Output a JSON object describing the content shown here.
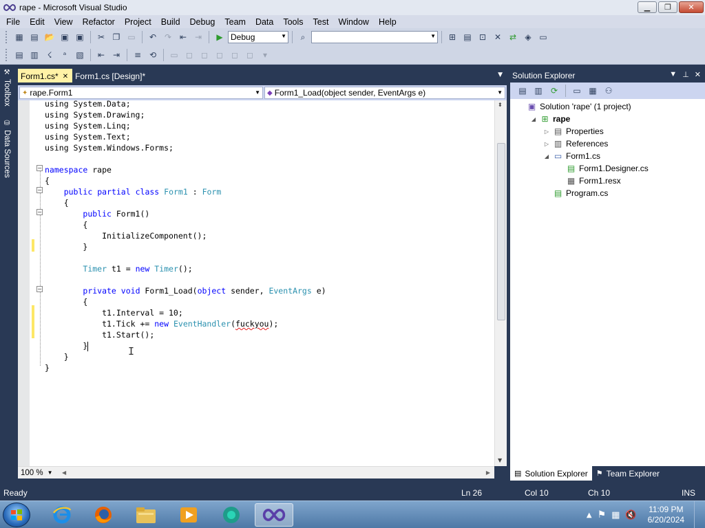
{
  "window": {
    "title": "rape - Microsoft Visual Studio",
    "icon": "vs-infinity-icon"
  },
  "menu": [
    "File",
    "Edit",
    "View",
    "Refactor",
    "Project",
    "Build",
    "Debug",
    "Team",
    "Data",
    "Tools",
    "Test",
    "Window",
    "Help"
  ],
  "toolbar": {
    "config_value": "Debug",
    "find_value": ""
  },
  "left_rail": {
    "toolbox": "Toolbox",
    "data_sources": "Data Sources"
  },
  "editor": {
    "tabs": [
      {
        "label": "Form1.cs*",
        "active": true
      },
      {
        "label": "Form1.cs [Design]*",
        "active": false
      }
    ],
    "nav_class": "rape.Form1",
    "nav_member": "Form1_Load(object sender, EventArgs e)",
    "zoom": "100 %",
    "code_lines": [
      [
        {
          "t": "using System.Data;"
        }
      ],
      [
        {
          "t": "using System.Drawing;"
        }
      ],
      [
        {
          "t": "using System.Linq;"
        }
      ],
      [
        {
          "t": "using System.Text;"
        }
      ],
      [
        {
          "t": "using System.Windows.Forms;"
        }
      ],
      [
        {
          "t": ""
        }
      ],
      [
        {
          "t": "namespace",
          "c": "kw"
        },
        {
          "t": " rape"
        }
      ],
      [
        {
          "t": "{"
        }
      ],
      [
        {
          "t": "    "
        },
        {
          "t": "public",
          "c": "kw"
        },
        {
          "t": " "
        },
        {
          "t": "partial",
          "c": "kw"
        },
        {
          "t": " "
        },
        {
          "t": "class",
          "c": "kw"
        },
        {
          "t": " "
        },
        {
          "t": "Form1",
          "c": "ty"
        },
        {
          "t": " : "
        },
        {
          "t": "Form",
          "c": "ty"
        }
      ],
      [
        {
          "t": "    {"
        }
      ],
      [
        {
          "t": "        "
        },
        {
          "t": "public",
          "c": "kw"
        },
        {
          "t": " Form1()"
        }
      ],
      [
        {
          "t": "        {"
        }
      ],
      [
        {
          "t": "            InitializeComponent();"
        }
      ],
      [
        {
          "t": "        }"
        }
      ],
      [
        {
          "t": ""
        }
      ],
      [
        {
          "t": "        "
        },
        {
          "t": "Timer",
          "c": "ty"
        },
        {
          "t": " t1 = "
        },
        {
          "t": "new",
          "c": "kw"
        },
        {
          "t": " "
        },
        {
          "t": "Timer",
          "c": "ty"
        },
        {
          "t": "();"
        }
      ],
      [
        {
          "t": ""
        }
      ],
      [
        {
          "t": "        "
        },
        {
          "t": "private",
          "c": "kw"
        },
        {
          "t": " "
        },
        {
          "t": "void",
          "c": "kw"
        },
        {
          "t": " Form1_Load("
        },
        {
          "t": "object",
          "c": "kw"
        },
        {
          "t": " sender, "
        },
        {
          "t": "EventArgs",
          "c": "ty"
        },
        {
          "t": " e)"
        }
      ],
      [
        {
          "t": "        {"
        }
      ],
      [
        {
          "t": "            t1.Interval = 10;"
        }
      ],
      [
        {
          "t": "            t1.Tick += "
        },
        {
          "t": "new",
          "c": "kw"
        },
        {
          "t": " "
        },
        {
          "t": "EventHandler",
          "c": "ty"
        },
        {
          "t": "("
        },
        {
          "t": "fuckyou",
          "c": "squig"
        },
        {
          "t": ");"
        }
      ],
      [
        {
          "t": "            t1.Start();"
        }
      ],
      [
        {
          "t": "        }"
        },
        {
          "t": "",
          "c": "caret"
        }
      ],
      [
        {
          "t": "    }"
        }
      ],
      [
        {
          "t": "}"
        }
      ]
    ]
  },
  "solution_explorer": {
    "title": "Solution Explorer",
    "items": [
      {
        "label": "Solution 'rape' (1 project)",
        "icon": "solution-icon",
        "level": 0,
        "expander": ""
      },
      {
        "label": "rape",
        "icon": "csharp-project-icon",
        "level": 1,
        "expander": "◢",
        "bold": true
      },
      {
        "label": "Properties",
        "icon": "properties-folder-icon",
        "level": 2,
        "expander": "▷"
      },
      {
        "label": "References",
        "icon": "references-folder-icon",
        "level": 2,
        "expander": "▷"
      },
      {
        "label": "Form1.cs",
        "icon": "form-icon",
        "level": 2,
        "expander": "◢"
      },
      {
        "label": "Form1.Designer.cs",
        "icon": "cs-file-icon",
        "level": 3,
        "expander": ""
      },
      {
        "label": "Form1.resx",
        "icon": "resx-file-icon",
        "level": 3,
        "expander": ""
      },
      {
        "label": "Program.cs",
        "icon": "cs-file-icon",
        "level": 2,
        "expander": ""
      }
    ],
    "tabs": [
      {
        "label": "Solution Explorer",
        "icon": "solution-explorer-icon",
        "active": true
      },
      {
        "label": "Team Explorer",
        "icon": "team-explorer-icon",
        "active": false
      }
    ]
  },
  "status": {
    "ready": "Ready",
    "ln": "Ln 26",
    "col": "Col 10",
    "ch": "Ch 10",
    "ins": "INS"
  },
  "taskbar": {
    "apps": [
      "internet-explorer-icon",
      "firefox-icon",
      "file-explorer-icon",
      "media-player-icon",
      "app-icon",
      "visual-studio-icon"
    ],
    "time": "11:09 PM",
    "date": "6/20/2024"
  },
  "colors": {
    "chrome": "#293955",
    "active_tab": "#fff2a6",
    "keyword": "#0000ff",
    "type": "#2b91af"
  }
}
